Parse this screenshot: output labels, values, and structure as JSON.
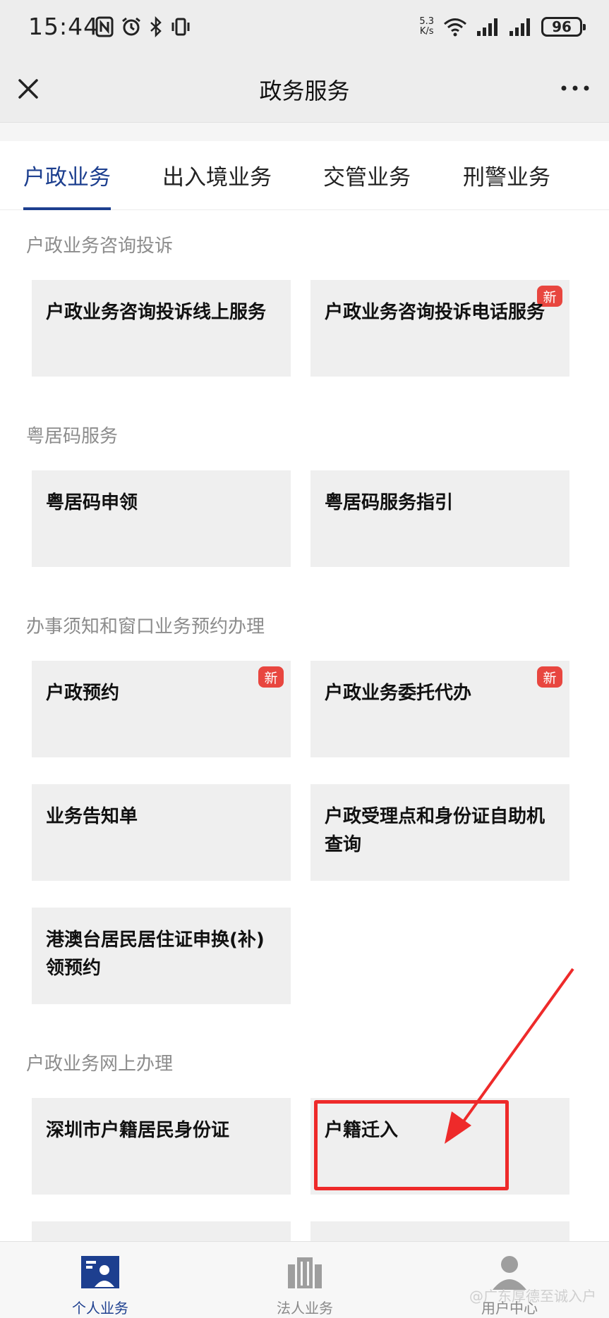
{
  "status_bar": {
    "time": "15:44",
    "net_speed_value": "5.3",
    "net_speed_unit": "K/s",
    "battery": "96"
  },
  "header": {
    "title": "政务服务"
  },
  "tabs": [
    {
      "label": "户政业务",
      "active": true
    },
    {
      "label": "出入境业务",
      "active": false
    },
    {
      "label": "交管业务",
      "active": false
    },
    {
      "label": "刑警业务",
      "active": false
    }
  ],
  "sections": [
    {
      "title": "户政业务咨询投诉",
      "cards": [
        {
          "label": "户政业务咨询投诉线上服务",
          "badge": ""
        },
        {
          "label": "户政业务咨询投诉电话服务",
          "badge": "新"
        }
      ]
    },
    {
      "title": "粤居码服务",
      "cards": [
        {
          "label": "粤居码申领",
          "badge": ""
        },
        {
          "label": "粤居码服务指引",
          "badge": ""
        }
      ]
    },
    {
      "title": "办事须知和窗口业务预约办理",
      "cards": [
        {
          "label": "户政预约",
          "badge": "新"
        },
        {
          "label": "户政业务委托代办",
          "badge": "新"
        },
        {
          "label": "业务告知单",
          "badge": ""
        },
        {
          "label": "户政受理点和身份证自助机查询",
          "badge": ""
        },
        {
          "label": "港澳台居民居住证申换(补)领预约",
          "badge": ""
        }
      ]
    },
    {
      "title": "户政业务网上办理",
      "cards": [
        {
          "label": "深圳市户籍居民身份证",
          "badge": ""
        },
        {
          "label": "户籍迁入",
          "badge": ""
        }
      ]
    }
  ],
  "bottom_nav": [
    {
      "label": "个人业务",
      "icon": "personal-business-icon",
      "active": true
    },
    {
      "label": "法人业务",
      "icon": "building-icon",
      "active": false
    },
    {
      "label": "用户中心",
      "icon": "user-icon",
      "active": false
    }
  ],
  "watermark": "@广东厚德至诚入户",
  "colors": {
    "accent": "#1d3f8f",
    "badge": "#e8463f",
    "annotation": "#ee2a2a",
    "card_bg": "#efefef"
  }
}
